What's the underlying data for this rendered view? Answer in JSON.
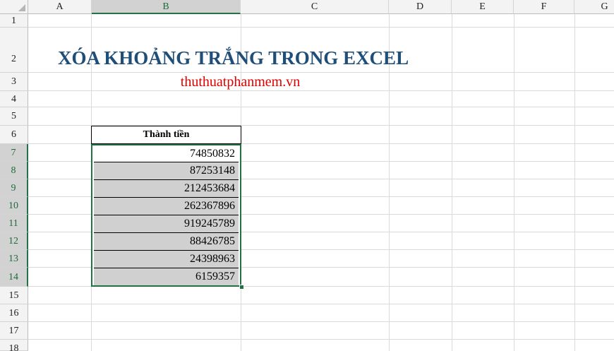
{
  "columns": [
    "A",
    "B",
    "C",
    "D",
    "E",
    "F",
    "G"
  ],
  "rows": [
    "1",
    "2",
    "3",
    "4",
    "5",
    "6",
    "7",
    "8",
    "9",
    "10",
    "11",
    "12",
    "13",
    "14",
    "15",
    "16",
    "17",
    "18"
  ],
  "title": "XÓA KHOẢNG TRẮNG TRONG EXCEL",
  "subtitle": "thuthuatphanmem.vn",
  "table": {
    "header": "Thành tiền",
    "values": [
      "74850832",
      "87253148",
      "212453684",
      "262367896",
      "919245789",
      "88426785",
      "24398963",
      "6159357"
    ]
  },
  "colors": {
    "title": "#1f4e79",
    "subtitle": "#e00000",
    "selection": "#217346",
    "selected_fill": "#d0d0d0"
  }
}
